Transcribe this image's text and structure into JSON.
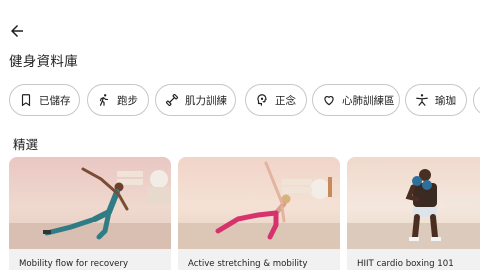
{
  "header": {
    "title": "健身資料庫",
    "back_icon": "arrow-left-icon"
  },
  "chips": [
    {
      "label": "已儲存",
      "icon": "bookmark-icon"
    },
    {
      "label": "跑步",
      "icon": "running-icon"
    },
    {
      "label": "肌力訓練",
      "icon": "dumbbell-icon"
    },
    {
      "label": "正念",
      "icon": "mindfulness-icon"
    },
    {
      "label": "心肺訓練區",
      "icon": "heart-icon"
    },
    {
      "label": "瑜珈",
      "icon": "yoga-icon"
    }
  ],
  "section": {
    "title": "精選"
  },
  "cards": [
    {
      "label": "Mobility flow for recovery"
    },
    {
      "label": "Active stretching & mobility"
    },
    {
      "label": "HIIT cardio boxing 101"
    }
  ]
}
